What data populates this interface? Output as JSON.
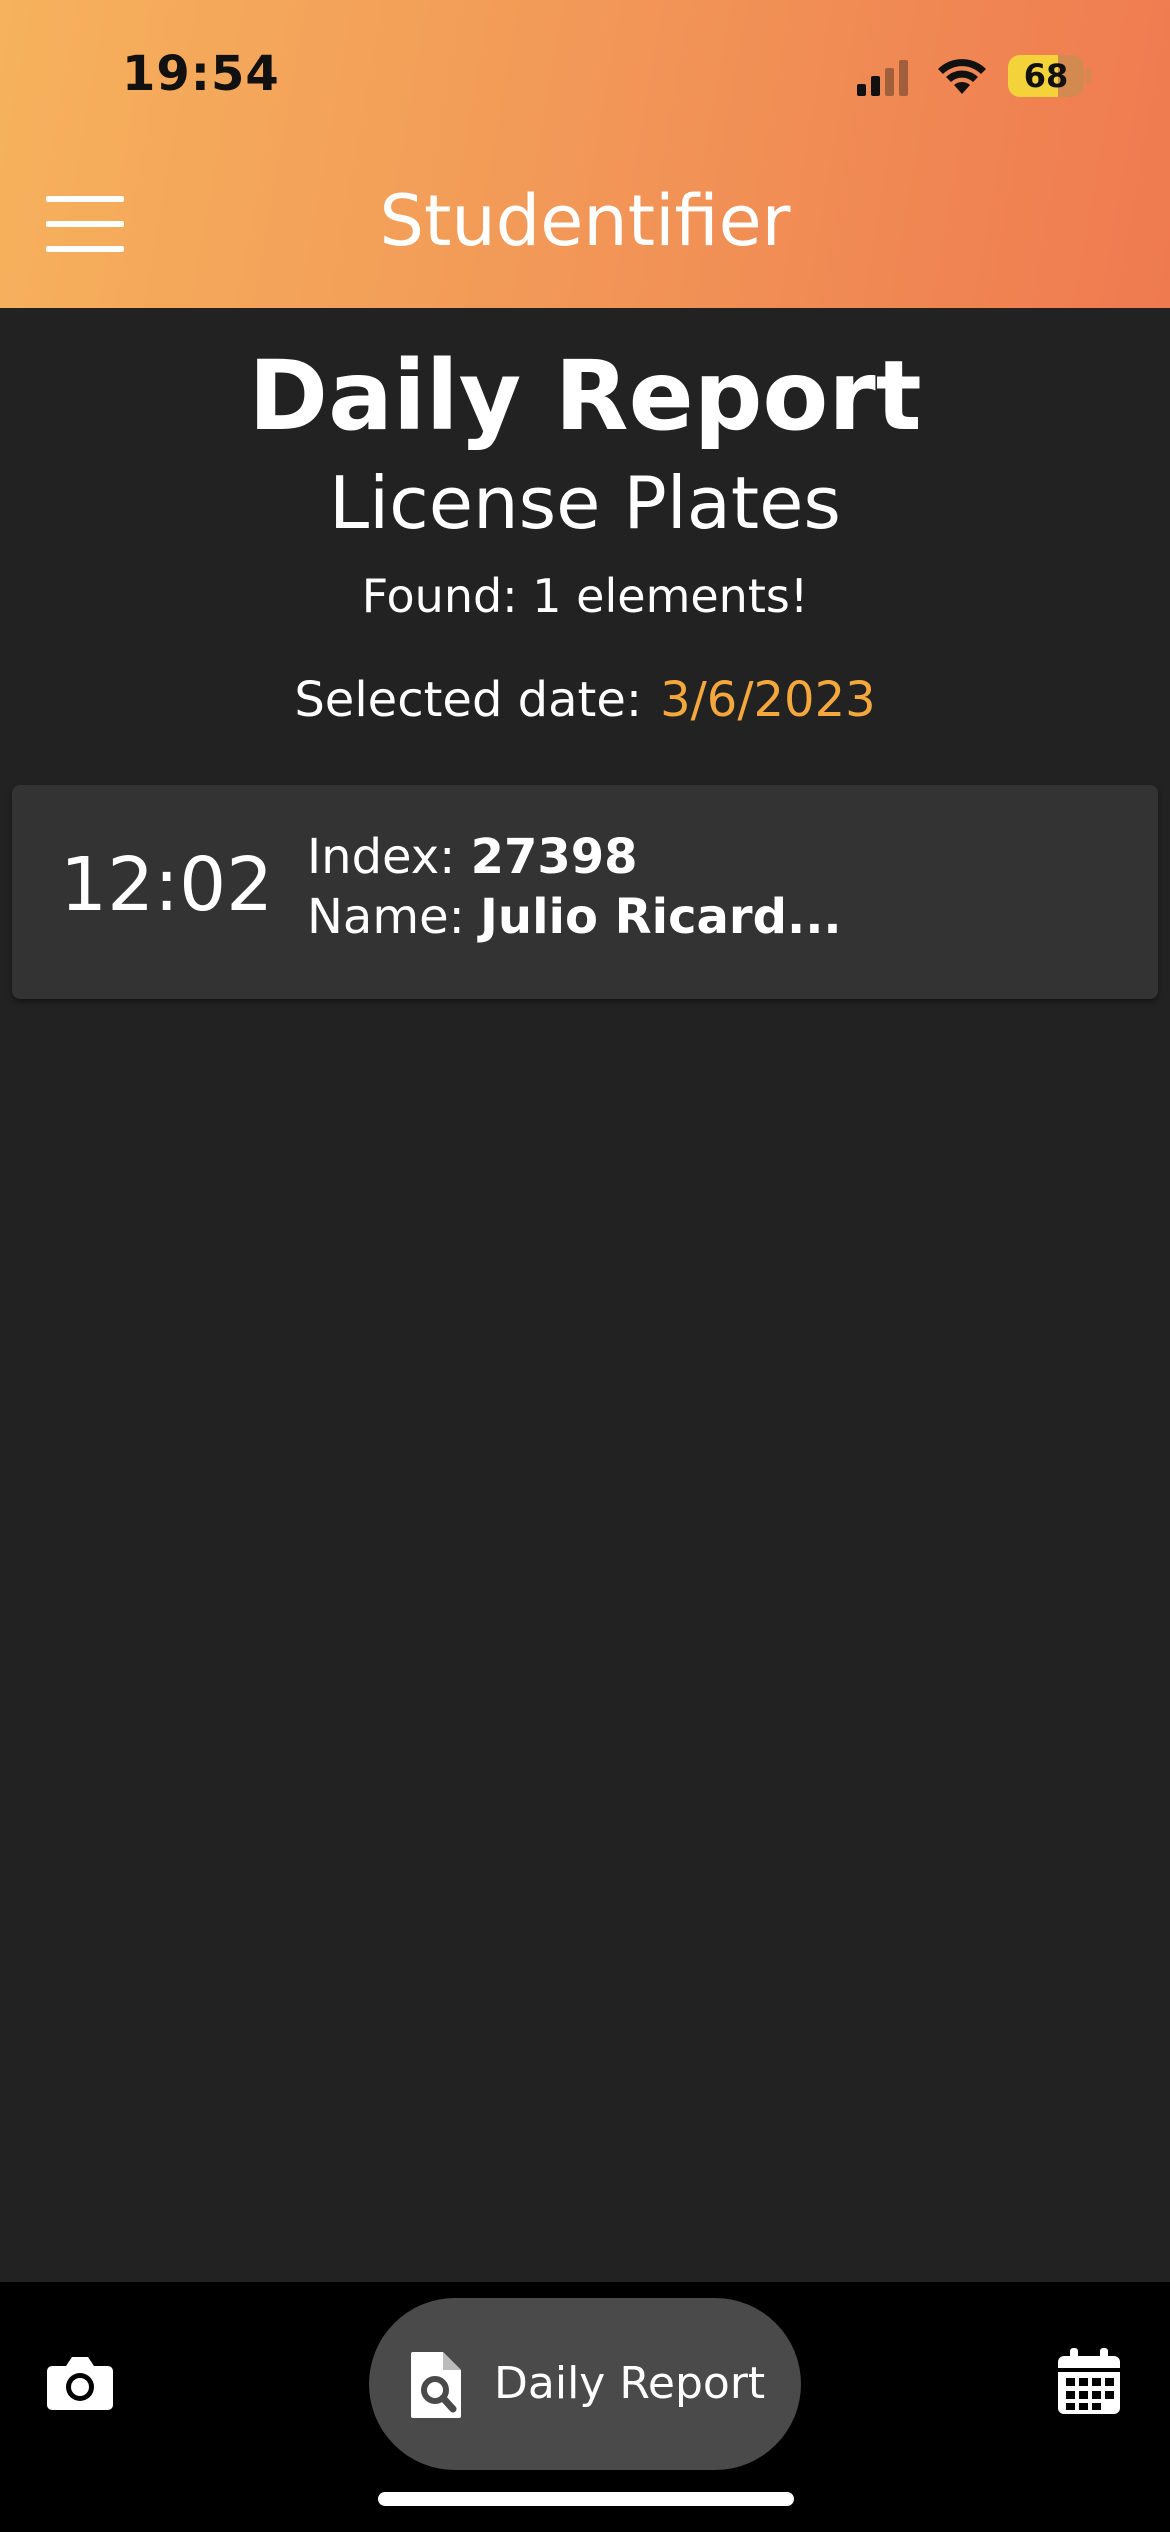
{
  "status_bar": {
    "time": "19:54",
    "battery": "68"
  },
  "header": {
    "title": "Studentifier",
    "menu_icon": "hamburger-menu-icon"
  },
  "report": {
    "title": "Daily Report",
    "subtitle": "License Plates",
    "found_text": "Found: 1 elements!",
    "date_label": "Selected date:",
    "date_value": "3/6/2023"
  },
  "entries": [
    {
      "time": "12:02",
      "index_label": "Index:",
      "index_value": "27398",
      "name_label": "Name:",
      "name_value": "Julio Ricard..."
    }
  ],
  "bottom_nav": {
    "left_icon": "camera-icon",
    "active_label": "Daily Report",
    "active_icon": "search-document-icon",
    "right_icon": "calendar-icon"
  },
  "colors": {
    "accent": "#f4a73c",
    "header_gradient_start": "#f6b25c",
    "header_gradient_end": "#ef7a50",
    "background": "#222222",
    "card": "#333333"
  }
}
